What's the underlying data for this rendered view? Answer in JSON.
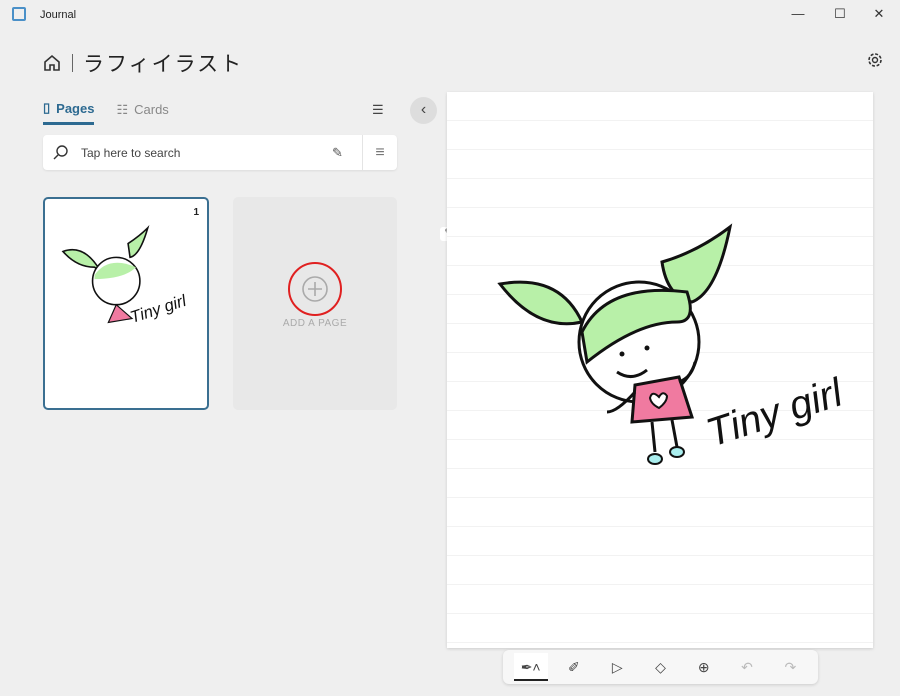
{
  "app": {
    "title": "Journal",
    "minimize": "—",
    "maximize": "☐",
    "close": "✕"
  },
  "header": {
    "notebook_title": "ラフィイラスト"
  },
  "tabs": [
    {
      "label": "Pages",
      "active": true
    },
    {
      "label": "Cards",
      "active": false
    }
  ],
  "search": {
    "placeholder": "Tap here to search"
  },
  "pages": [
    {
      "number": "1",
      "drawing_text": "Tiny girl"
    }
  ],
  "add_page": {
    "label": "ADD A PAGE"
  },
  "canvas": {
    "drawing_text": "Tiny girl"
  },
  "toolbar": {
    "tools": [
      "pen",
      "highlighter",
      "ink-select",
      "eraser",
      "insert",
      "undo",
      "redo"
    ],
    "active": "pen"
  },
  "colors": {
    "accent": "#2d6a91",
    "hair": "#b8f0a8",
    "dress": "#f07aa0",
    "highlight_circle": "#e02020"
  }
}
